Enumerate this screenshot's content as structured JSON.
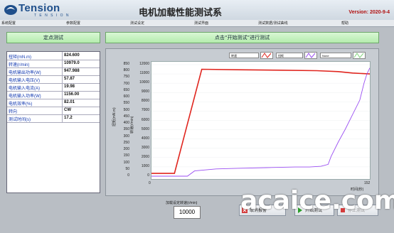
{
  "header": {
    "logo_text": "Tension",
    "logo_sub": "T E N S I O N",
    "title": "电机加载性能测试系",
    "version": "Version: 2020-9-4"
  },
  "menu": [
    "系统配置",
    "参数配置",
    "测试设定",
    "测试界面",
    "测试数据/测试曲线",
    "帮助"
  ],
  "buttons": {
    "single_point": "定点测试",
    "prompt": "点击“开始测试”进行测试",
    "cancel": "取消报警",
    "start": "开始测试",
    "stop": "停止测试"
  },
  "table": {
    "rows": [
      {
        "label": "扭矩(mN.m)",
        "value": "824.600"
      },
      {
        "label": "转速(r/min)",
        "value": "10979.0"
      },
      {
        "label": "电机输出功率(W)",
        "value": "947.988"
      },
      {
        "label": "电机输入电压(V)",
        "value": "57.87"
      },
      {
        "label": "电机输入电流(A)",
        "value": "19.98"
      },
      {
        "label": "电机输入功率(W)",
        "value": "1156.00"
      },
      {
        "label": "电机效率(%)",
        "value": "82.01"
      },
      {
        "label": "转向",
        "value": "CW"
      },
      {
        "label": "测试时间(s)",
        "value": "17.2"
      }
    ]
  },
  "chart_controls": {
    "left_select": "转速",
    "right_select": "扭矩",
    "none_select": "None"
  },
  "chart_data": {
    "type": "line",
    "x_axis": {
      "min": 0,
      "max": 152,
      "tick_labels": [
        "0",
        "152"
      ],
      "label": "时间(秒)"
    },
    "y_left": {
      "min": 0,
      "max": 12000,
      "ticks": [
        0,
        1000,
        2000,
        3000,
        4000,
        5000,
        6000,
        7000,
        8000,
        9000,
        10000,
        11000,
        12000
      ],
      "label": "转速(r/min)"
    },
    "y_right": {
      "min": 0,
      "max": 850,
      "ticks": [
        0,
        50,
        100,
        150,
        200,
        250,
        300,
        350,
        400,
        450,
        500,
        550,
        600,
        650,
        700,
        750,
        800,
        850
      ],
      "label": "扭矩(mN.m)"
    },
    "series": [
      {
        "name": "转速",
        "color": "#e0251e",
        "x": [
          0,
          12,
          16,
          35,
          60,
          90,
          115,
          130,
          140,
          152
        ],
        "y": [
          300,
          300,
          300,
          11500,
          11450,
          11400,
          11350,
          11250,
          11100,
          11000
        ]
      },
      {
        "name": "扭矩",
        "color": "#9a4ef2",
        "x": [
          0,
          5,
          20,
          25,
          30,
          45,
          60,
          80,
          100,
          110,
          118,
          123,
          125,
          130,
          135,
          140,
          145,
          148,
          150,
          152
        ],
        "y": [
          0,
          0,
          0,
          0,
          40,
          55,
          60,
          65,
          70,
          70,
          75,
          90,
          150,
          260,
          360,
          470,
          580,
          710,
          780,
          825
        ]
      }
    ]
  },
  "bottom": {
    "set_label": "加载设定转速(r/min)",
    "set_value": "10000",
    "watermark": "acaice.com"
  },
  "colors": {
    "accent_green": "#b4ecae",
    "speed": "#e0251e",
    "torque": "#9a4ef2"
  }
}
